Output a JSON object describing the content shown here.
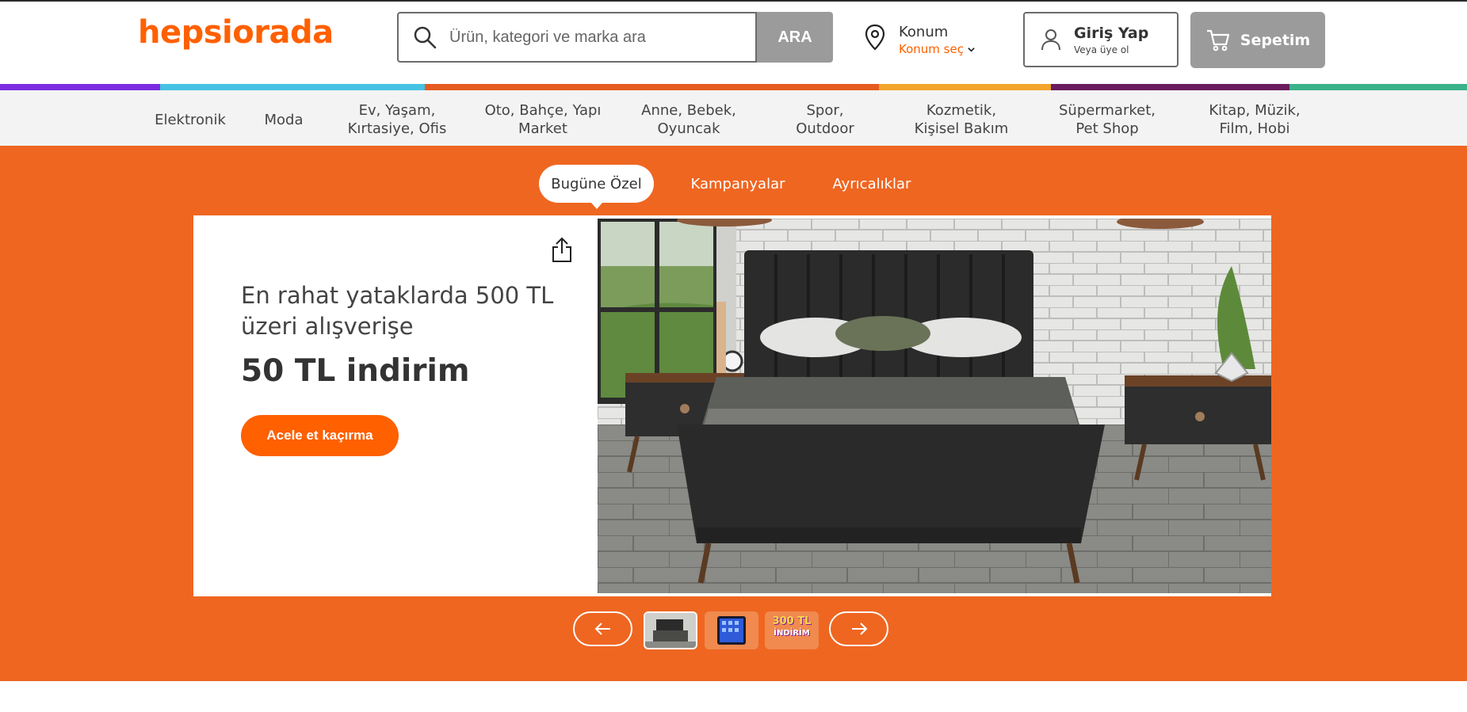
{
  "header": {
    "logo": "hepsiorada",
    "search": {
      "placeholder": "Ürün, kategori ve marka ara",
      "button": "ARA"
    },
    "location": {
      "title": "Konum",
      "subtitle": "Konum seç"
    },
    "login": {
      "title": "Giriş Yap",
      "subtitle": "Veya üye ol"
    },
    "cart": {
      "label": "Sepetim"
    }
  },
  "categories": [
    {
      "line1": "Elektronik",
      "line2": ""
    },
    {
      "line1": "Moda",
      "line2": ""
    },
    {
      "line1": "Ev, Yaşam,",
      "line2": "Kırtasiye, Ofis"
    },
    {
      "line1": "Oto, Bahçe, Yapı",
      "line2": "Market"
    },
    {
      "line1": "Anne, Bebek,",
      "line2": "Oyuncak"
    },
    {
      "line1": "Spor,",
      "line2": "Outdoor"
    },
    {
      "line1": "Kozmetik,",
      "line2": "Kişisel Bakım"
    },
    {
      "line1": "Süpermarket,",
      "line2": "Pet Shop"
    },
    {
      "line1": "Kitap, Müzik,",
      "line2": "Film, Hobi"
    }
  ],
  "category_strip_colors": [
    "#7c2ce0",
    "#46c2e3",
    "#e65b20",
    "#f2a42c",
    "#6a1c5e",
    "#3ab28a"
  ],
  "hero": {
    "tabs": [
      "Bugüne Özel",
      "Kampanyalar",
      "Ayrıcalıklar"
    ],
    "active_tab": "Bugüne Özel",
    "promo_line1": "En rahat yataklarda 500 TL üzeri alışverişe",
    "promo_line2": "50 TL indirim",
    "cta": "Acele et kaçırma",
    "thumbnail3_text_top": "300 TL",
    "thumbnail3_text_bottom": "İNDİRİM"
  },
  "colors": {
    "brand": "#ff6000",
    "hero_bg": "#ef6621",
    "button_gray": "#9b9b9b"
  }
}
